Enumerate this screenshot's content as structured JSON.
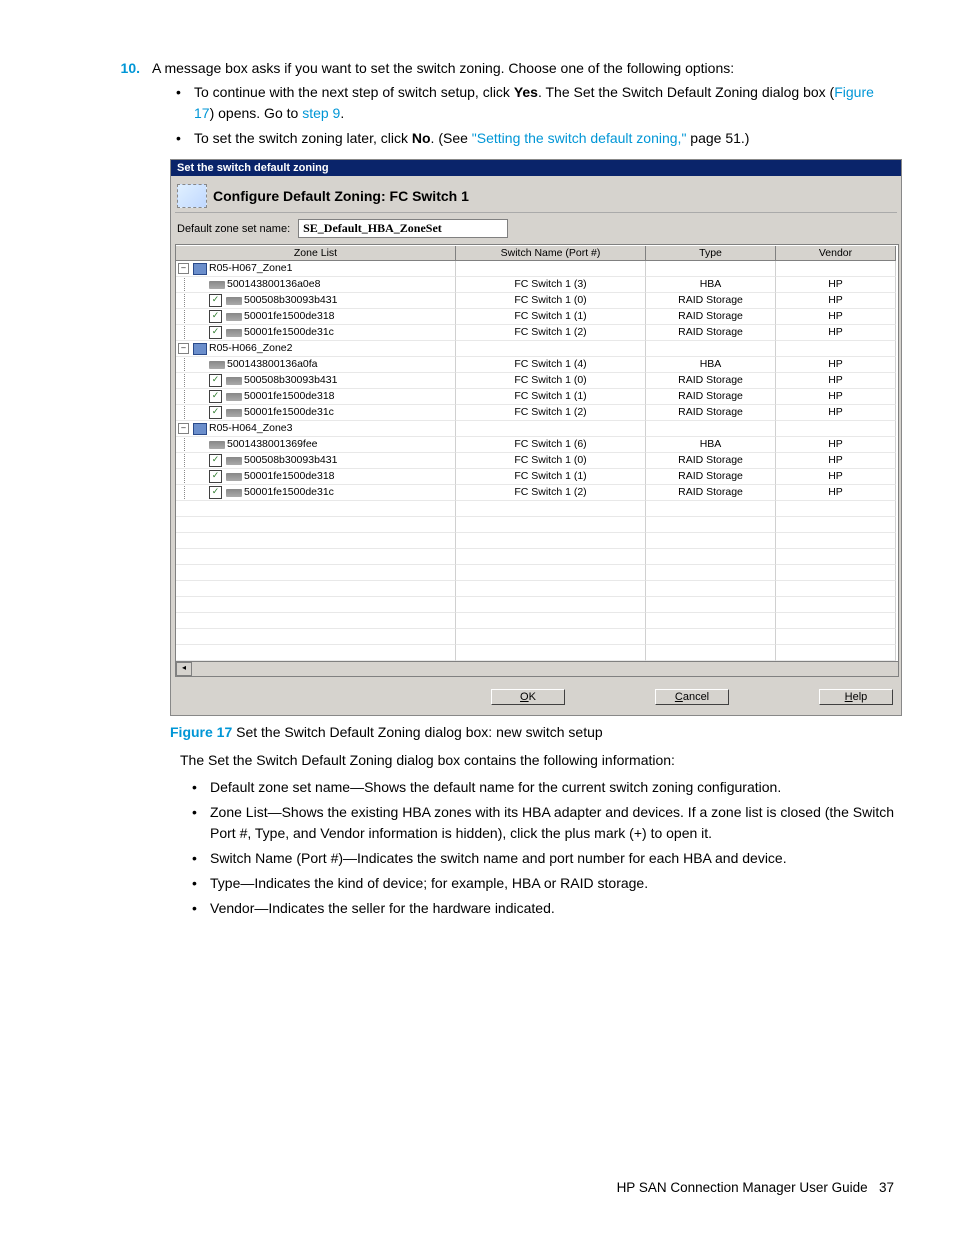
{
  "step": {
    "number": "10.",
    "text_head": "A message box asks if you want to set the switch zoning. Choose one of the following options:",
    "bullets": [
      {
        "pre": "To continue with the next step of switch setup, click ",
        "bold1": "Yes",
        "mid": ". The Set the Switch Default Zoning dialog box (",
        "link1": "Figure 17",
        "mid2": ") opens. Go to ",
        "link2": "step 9",
        "tail": "."
      },
      {
        "pre": "To set the switch zoning later, click ",
        "bold1": "No",
        "mid": ". (See ",
        "link1": "\"Setting the switch default zoning,\"",
        "tail": " page 51.)"
      }
    ]
  },
  "dialog": {
    "title": "Set the switch default zoning",
    "header": "Configure Default Zoning: FC Switch 1",
    "zsname_label": "Default zone set name:",
    "zsname_value": "SE_Default_HBA_ZoneSet",
    "columns": [
      "Zone List",
      "Switch Name (Port #)",
      "Type",
      "Vendor"
    ],
    "rows": [
      {
        "kind": "zone",
        "label": "R05-H067_Zone1"
      },
      {
        "kind": "hba",
        "label": "500143800136a0e8",
        "switch": "FC Switch 1 (3)",
        "type": "HBA",
        "vendor": "HP"
      },
      {
        "kind": "raid",
        "label": "500508b30093b431",
        "switch": "FC Switch 1 (0)",
        "type": "RAID Storage",
        "vendor": "HP"
      },
      {
        "kind": "raid",
        "label": "50001fe1500de318",
        "switch": "FC Switch 1 (1)",
        "type": "RAID Storage",
        "vendor": "HP"
      },
      {
        "kind": "raid",
        "label": "50001fe1500de31c",
        "switch": "FC Switch 1 (2)",
        "type": "RAID Storage",
        "vendor": "HP"
      },
      {
        "kind": "zone",
        "label": "R05-H066_Zone2"
      },
      {
        "kind": "hba",
        "label": "500143800136a0fa",
        "switch": "FC Switch 1 (4)",
        "type": "HBA",
        "vendor": "HP"
      },
      {
        "kind": "raid",
        "label": "500508b30093b431",
        "switch": "FC Switch 1 (0)",
        "type": "RAID Storage",
        "vendor": "HP"
      },
      {
        "kind": "raid",
        "label": "50001fe1500de318",
        "switch": "FC Switch 1 (1)",
        "type": "RAID Storage",
        "vendor": "HP"
      },
      {
        "kind": "raid",
        "label": "50001fe1500de31c",
        "switch": "FC Switch 1 (2)",
        "type": "RAID Storage",
        "vendor": "HP"
      },
      {
        "kind": "zone",
        "label": "R05-H064_Zone3"
      },
      {
        "kind": "hba",
        "label": "5001438001369fee",
        "switch": "FC Switch 1 (6)",
        "type": "HBA",
        "vendor": "HP"
      },
      {
        "kind": "raid",
        "label": "500508b30093b431",
        "switch": "FC Switch 1 (0)",
        "type": "RAID Storage",
        "vendor": "HP"
      },
      {
        "kind": "raid",
        "label": "50001fe1500de318",
        "switch": "FC Switch 1 (1)",
        "type": "RAID Storage",
        "vendor": "HP"
      },
      {
        "kind": "raid",
        "label": "50001fe1500de31c",
        "switch": "FC Switch 1 (2)",
        "type": "RAID Storage",
        "vendor": "HP"
      }
    ],
    "empty_rows": 10,
    "buttons": {
      "ok": "OK",
      "cancel": "Cancel",
      "help": "Help"
    }
  },
  "caption": {
    "fig": "Figure 17",
    "text": "  Set the Switch Default Zoning dialog box: new switch setup"
  },
  "after": {
    "intro": "The Set the Switch Default Zoning dialog box contains the following information:",
    "bullets": [
      "Default zone set name—Shows the default name for the current switch zoning configuration.",
      "Zone List—Shows the existing HBA zones with its HBA adapter and devices. If a zone list is closed (the Switch Port #, Type, and Vendor information is hidden), click the plus mark (+) to open it.",
      "Switch Name (Port #)—Indicates the switch name and port number for each HBA and device.",
      "Type—Indicates the kind of device; for example, HBA or RAID storage.",
      "Vendor—Indicates the seller for the hardware indicated."
    ]
  },
  "footer": {
    "title": "HP SAN Connection Manager User Guide",
    "page": "37"
  }
}
